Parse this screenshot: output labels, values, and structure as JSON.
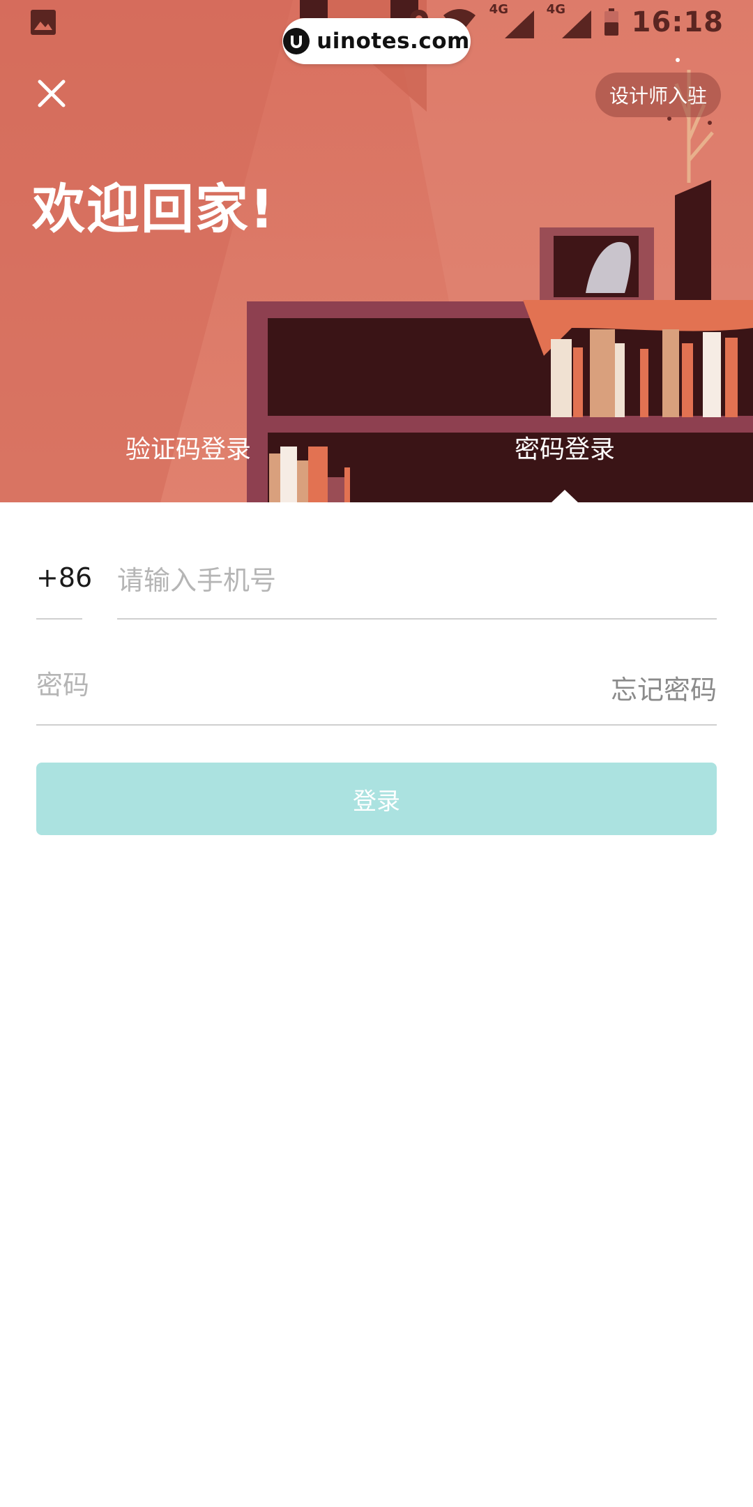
{
  "status_bar": {
    "time": "16:18",
    "network_label_1": "4G",
    "network_label_2": "4G",
    "icons": [
      "image-icon",
      "location-icon",
      "wifi-icon",
      "signal-icon",
      "signal-icon",
      "battery-icon"
    ]
  },
  "watermark": {
    "text": "uinotes.com"
  },
  "header": {
    "close_icon": "close-icon",
    "designer_button_label": "设计师入驻",
    "welcome_title": "欢迎回家!"
  },
  "tabs": [
    {
      "label": "验证码登录",
      "active": false
    },
    {
      "label": "密码登录",
      "active": true
    }
  ],
  "form": {
    "country_code": "+86",
    "phone_placeholder": "请输入手机号",
    "phone_value": "",
    "password_placeholder": "密码",
    "password_value": "",
    "forgot_password_label": "忘记密码",
    "login_button_label": "登录"
  },
  "colors": {
    "hero_background": "#dc7a68",
    "login_button": "#abe2e0",
    "divider": "#cfcfcf",
    "placeholder": "#b5b5b5"
  }
}
